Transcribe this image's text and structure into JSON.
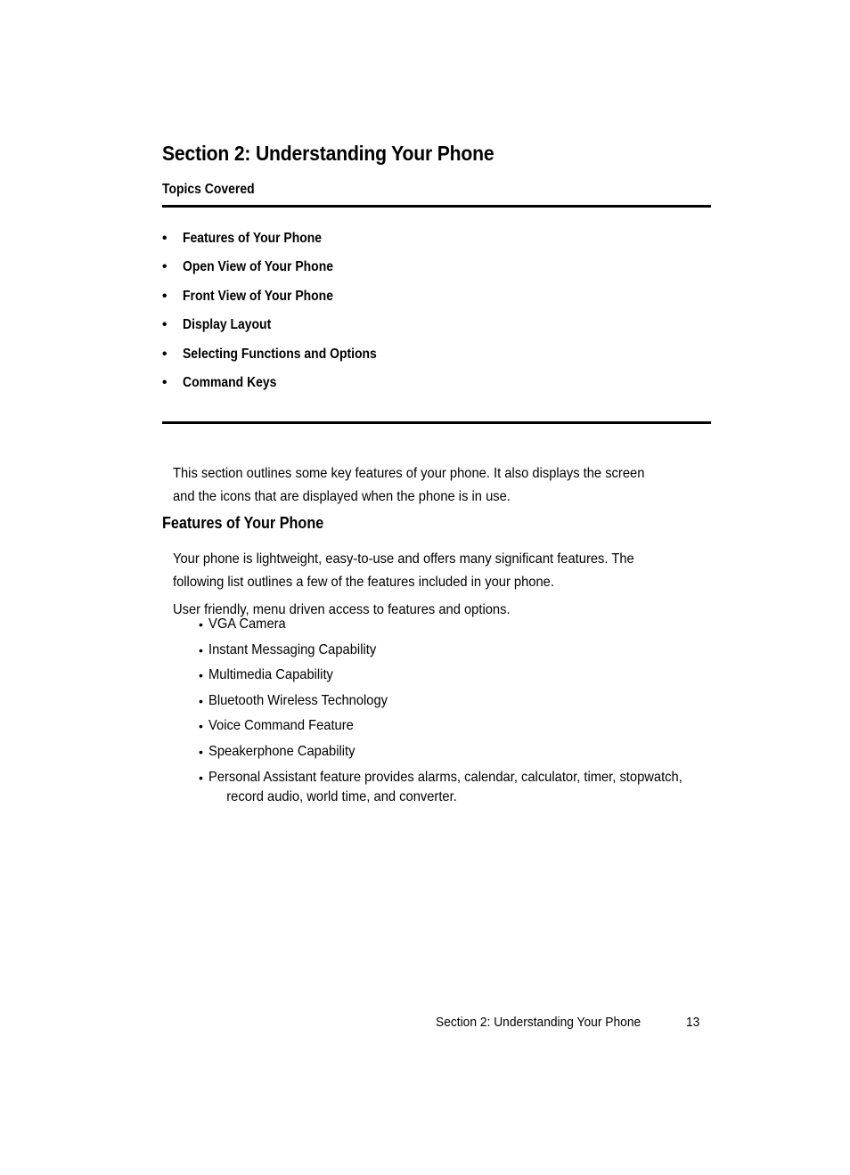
{
  "page": {
    "section_title": "Section 2: Understanding Your Phone",
    "topics_label": "Topics Covered",
    "topics": [
      {
        "bullet": "•",
        "label": "Features of Your Phone"
      },
      {
        "bullet": "•",
        "label": "Open View of Your Phone"
      },
      {
        "bullet": "•",
        "label": "Front View of Your Phone"
      },
      {
        "bullet": "•",
        "label": "Display Layout"
      },
      {
        "bullet": "•",
        "label": "Selecting Functions and Options"
      },
      {
        "bullet": "•",
        "label": "Command Keys"
      }
    ],
    "intro_paragraph": "This section outlines some key features of your phone. It also displays the screen and the icons that are displayed when the phone is in use.",
    "features_heading": "Features of Your Phone",
    "body_paragraph_1": "Your phone is lightweight, easy-to-use and offers many significant features. The following list outlines a few of the features included in your phone.",
    "body_paragraph_2": "User friendly, menu driven access to features and options.",
    "features": [
      {
        "bullet": "•",
        "label": "VGA Camera"
      },
      {
        "bullet": "•",
        "label": "Instant Messaging Capability"
      },
      {
        "bullet": "•",
        "label": "Multimedia Capability"
      },
      {
        "bullet": "•",
        "label": "Bluetooth Wireless Technology"
      },
      {
        "bullet": "•",
        "label": "Voice Command Feature"
      },
      {
        "bullet": "•",
        "label": "Speakerphone Capability"
      }
    ],
    "features_last": {
      "bullet": "•",
      "line1": "Personal Assistant feature provides alarms, calendar, calculator, timer, stopwatch,",
      "line2": "record audio, world time, and converter."
    },
    "footer": {
      "text": "Section 2: Understanding Your Phone",
      "page_number": "13"
    },
    "colors": {
      "background": "#ffffff",
      "text": "#000000",
      "rule": "#000000"
    }
  }
}
